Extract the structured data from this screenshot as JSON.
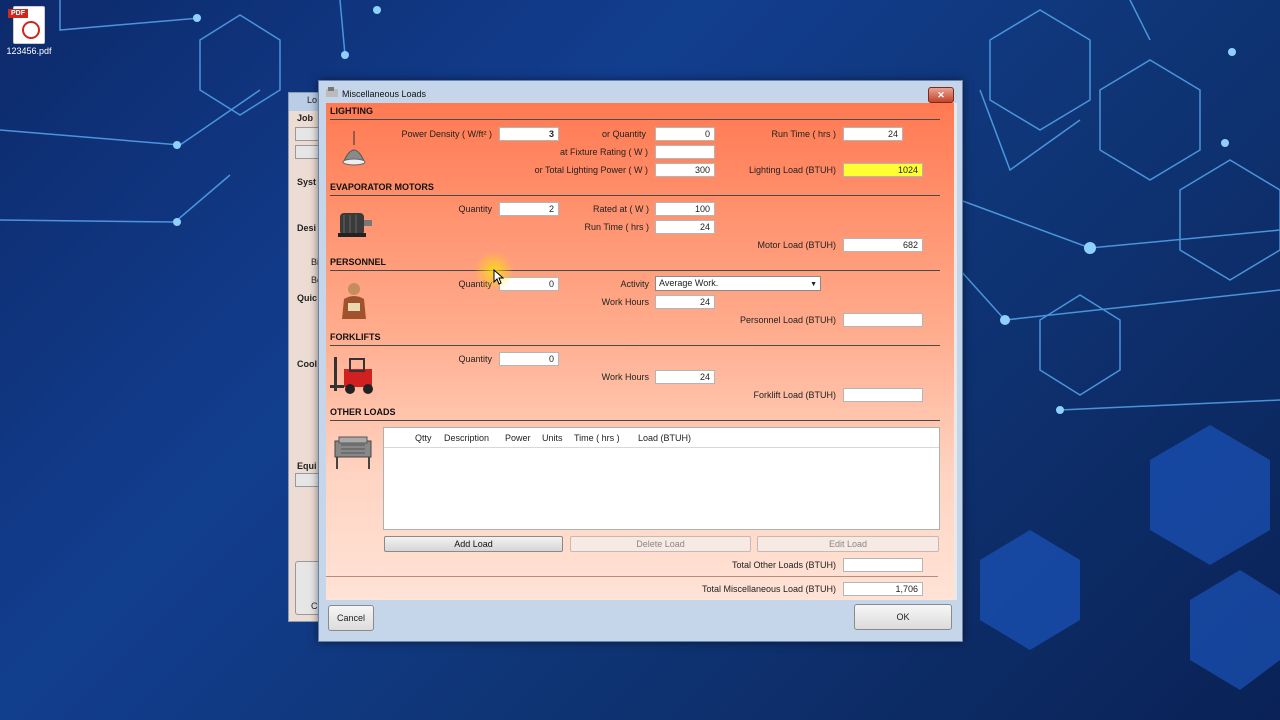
{
  "desktop": {
    "file_name": "123456.pdf",
    "pdf_tag": "PDF"
  },
  "background_window": {
    "title_fragment": "Lo",
    "labels": [
      "Job",
      "Syst",
      "Desi",
      "Bi",
      "Bo",
      "Quic",
      "Cool",
      "Equi",
      "C"
    ]
  },
  "dialog": {
    "title": "Miscellaneous Loads",
    "close_symbol": "✕",
    "lighting": {
      "section": "LIGHTING",
      "power_density_label": "Power Density ( W/ft² )",
      "power_density_value": "3",
      "or_quantity_label": "or Quantity",
      "quantity_value": "0",
      "run_time_label": "Run Time ( hrs )",
      "run_time_value": "24",
      "fixture_rating_label": "at Fixture Rating ( W )",
      "fixture_rating_value": "",
      "total_power_label": "or Total Lighting Power ( W )",
      "total_power_value": "300",
      "load_label": "Lighting Load (BTUH)",
      "load_value": "1024"
    },
    "evaporator": {
      "section": "EVAPORATOR MOTORS",
      "quantity_label": "Quantity",
      "quantity_value": "2",
      "rated_label": "Rated at ( W )",
      "rated_value": "100",
      "run_time_label": "Run Time ( hrs )",
      "run_time_value": "24",
      "load_label": "Motor Load (BTUH)",
      "load_value": "682"
    },
    "personnel": {
      "section": "PERSONNEL",
      "quantity_label": "Quantity",
      "quantity_value": "0",
      "activity_label": "Activity",
      "activity_value": "Average Work.",
      "hours_label": "Work Hours",
      "hours_value": "24",
      "load_label": "Personnel Load (BTUH)",
      "load_value": ""
    },
    "forklifts": {
      "section": "FORKLIFTS",
      "quantity_label": "Quantity",
      "quantity_value": "0",
      "hours_label": "Work Hours",
      "hours_value": "24",
      "load_label": "Forklift Load (BTUH)",
      "load_value": ""
    },
    "other": {
      "section": "OTHER LOADS",
      "columns": [
        "Qtty",
        "Description",
        "Power",
        "Units",
        "Time ( hrs )",
        "Load (BTUH)"
      ],
      "add_label": "Add Load",
      "delete_label": "Delete Load",
      "edit_label": "Edit Load",
      "total_other_label": "Total Other Loads (BTUH)",
      "total_other_value": ""
    },
    "total_misc_label": "Total Miscellaneous Load (BTUH)",
    "total_misc_value": "1,706",
    "cancel_label": "Cancel",
    "ok_label": "OK"
  }
}
